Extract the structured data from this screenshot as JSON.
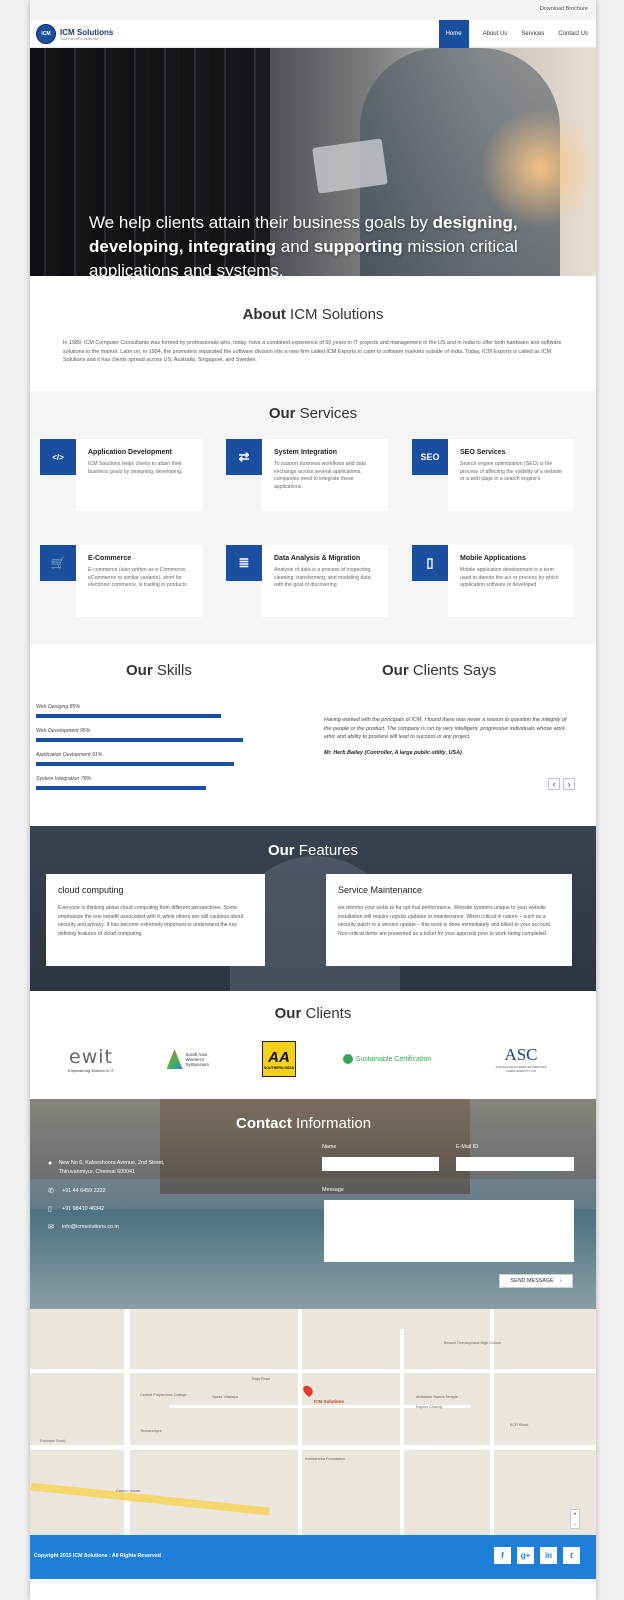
{
  "topbar": {
    "download": "Download Brochure"
  },
  "brand": {
    "mark": "ICM",
    "name": "ICM Solutions",
    "tagline": "Your Partner in Business"
  },
  "nav": [
    "Home",
    "About Us",
    "Services",
    "Contact Us"
  ],
  "hero": {
    "p1": "We help clients attain their business goals by ",
    "b1": "designing,",
    "b2": "developing, integrating",
    "p2": " and ",
    "b3": "supporting",
    "p3": " mission critical applications and systems."
  },
  "about": {
    "title_bold": "About",
    "title_rest": " ICM Solutions",
    "text": "In 1989, ICM Computer Consultants was formed by professionals who, today, have a combined experience of 50 years in IT projects and management in the US and in India to offer both hardware and software solutions to the market. Later on, in 1994, the promoters separated the software division into a new firm called ICM Exports to cater to software markets outside of India. Today, ICM Exports is called as ICM Solutions and it has clients spread across US, Australia, Singapore, and Sweden."
  },
  "services": {
    "title_bold": "Our",
    "title_rest": " Services",
    "items": [
      {
        "icon": "monitor-icon",
        "glyph": "</>",
        "title": "Application Development",
        "text": "ICM Solutions helps clients to attain their business goals by designing, developing,"
      },
      {
        "icon": "sync-icon",
        "glyph": "⇄",
        "title": "System Integration",
        "text": "To support business workflows and data exchange across several applications, companies need to integrate these applications."
      },
      {
        "icon": "seo-icon",
        "glyph": "SEO",
        "title": "SEO Services",
        "text": "Search engine optimization (SEO) is the process of affecting the visibility of a website or a web page in a search engine's"
      },
      {
        "icon": "cart-icon",
        "glyph": "🛒",
        "title": "E-Commerce",
        "text": "E-commerce (also written as e-Commerce, eCommerce or similar variants), short for electronic commerce, is trading in products"
      },
      {
        "icon": "database-icon",
        "glyph": "≣",
        "title": "Data Analysis & Migration",
        "text": "Analysis of data is a process of inspecting, cleaning, transforming, and modeling data with the goal of discovering"
      },
      {
        "icon": "mobile-icon",
        "glyph": "▯",
        "title": "Mobile Applications",
        "text": "Mobile application development is a term used to denote the act or process by which application software is developed"
      }
    ]
  },
  "skills": {
    "title_bold": "Our",
    "title_rest": " Skills",
    "items": [
      {
        "label": "Web Desiging 85%",
        "value": 85
      },
      {
        "label": "Web Development 95%",
        "value": 95
      },
      {
        "label": "Application Devlopment 91%",
        "value": 91
      },
      {
        "label": "System Integration 78%",
        "value": 78
      }
    ]
  },
  "testimonial": {
    "title_bold": "Our",
    "title_rest": " Clients Says",
    "quote": "Having worked with the principals of ICM, I found there was never a reason to question the integrity of the people or the product. The company is run by very intelligent, progressive individuals whose work ethic and ability to produce will lead to success in any project.",
    "author": "Mr. Herb Bailey (Controller, A large public utility, USA)",
    "prev": "‹",
    "next": "›"
  },
  "features": {
    "title_bold": "Our",
    "title_rest": " Features",
    "items": [
      {
        "title": "cloud computing",
        "text": "Everyone is thinking about cloud computing from different perspectives. Some emphasize the one benefit associated with it, while others are still cautious about security and privacy. It has become extremely important to understand the key defining features of cloud computing"
      },
      {
        "title": "Service Maintenance",
        "text": "we monitor your webs te for opt mal performance. Website systems unique to your website installation will require regular updates or maintenance. When critical in nature – such as a security patch or a version update – this work is done immediately and billed to your account. Non-critical items are presented as a ticket for your approval prior to work being completed."
      }
    ]
  },
  "clients": {
    "title_bold": "Our",
    "title_rest": " Clients",
    "ewit": "ewit",
    "ewit_sub": "Empowering Women In IT",
    "saw": "South Asia Women's Symposium",
    "aa": "AA",
    "aa_sub": "SOUTHERN INDIA",
    "sust": "Sustainable Certification",
    "asc": "ASC",
    "asc_sub": "AUSTRALIAN ACCREDITED SERVICES COMPLIANCE PTY LTD"
  },
  "contact": {
    "title_bold": "Contact",
    "title_rest": " Information",
    "address": "New No 6, Kaleeshoora Avenue, 2nd Street, Thiruvanmiyur, Chennai 600041",
    "phone1": "+91 44 6459 2222",
    "phone2": "+91 98410 46342",
    "email": "info@icmsolutions.co.in",
    "name_label": "Name",
    "email_label": "E-Mail ID",
    "message_label": "Message",
    "send": "SEND MESSAGE"
  },
  "map": {
    "pin_label": "ICM Solutions",
    "zoom_in": "+",
    "zoom_out": "−",
    "labels": [
      "Besant Theosophical High School",
      "Central Polytechnic College",
      "Vyasa Vidalaya",
      "Kalakshetra Foundation",
      "Ambalam Swami Temple",
      "Kapoor Chandy",
      "ECR Block",
      "Carbon House",
      "Rukmani Road",
      "Raja Road",
      "Tiruvanmiyur"
    ]
  },
  "footer": {
    "copyright": "Copyright 2015 ICM Solutions : All Rights Reserved"
  },
  "social": [
    "f",
    "g+",
    "in",
    "t"
  ],
  "colors": {
    "brand": "#1a4fa0",
    "footer": "#1d7fd8"
  }
}
